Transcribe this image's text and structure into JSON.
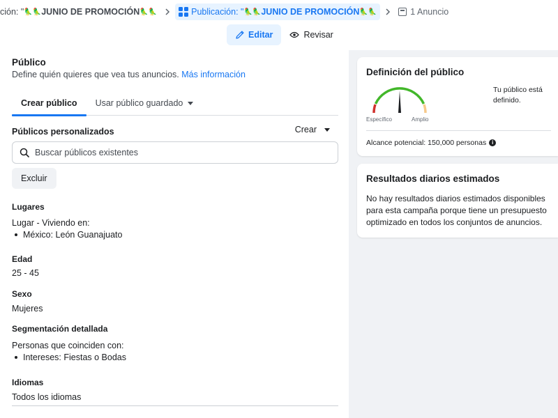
{
  "breadcrumbs": {
    "campaign": {
      "prefix": "ción: \"",
      "emoji_left": "🦜🦜",
      "name": "JUNIO DE PROMOCIÓN",
      "emoji_right": "🦜🦜"
    },
    "adset": {
      "prefix": "Publicación: \"",
      "emoji_left": "🦜🦜",
      "name": "JUNIO DE PROMOCIÓN",
      "emoji_right": "🦜🦜"
    },
    "ad": {
      "label": "1 Anuncio"
    }
  },
  "modes": {
    "edit": "Editar",
    "review": "Revisar"
  },
  "audience": {
    "title": "Público",
    "description": "Define quién quieres que vea tus anuncios.",
    "more_info": "Más información",
    "tabs": {
      "create": "Crear público",
      "saved": "Usar público guardado"
    },
    "custom": {
      "label": "Públicos personalizados",
      "create_label": "Crear",
      "search_placeholder": "Buscar públicos existentes",
      "exclude_label": "Excluir"
    },
    "locations": {
      "label": "Lugares",
      "prefix": "Lugar - Viviendo en:",
      "items": [
        "México: León Guanajuato"
      ]
    },
    "age": {
      "label": "Edad",
      "value": "25 - 45"
    },
    "gender": {
      "label": "Sexo",
      "value": "Mujeres"
    },
    "detailed": {
      "label": "Segmentación detallada",
      "prefix": "Personas que coinciden con:",
      "items": [
        "Intereses: Fiestas o Bodas"
      ]
    },
    "languages": {
      "label": "Idiomas",
      "value": "Todos los idiomas"
    }
  },
  "definition_card": {
    "title": "Definición del público",
    "specific_label": "Específico",
    "broad_label": "Amplio",
    "status": "Tu público está definido.",
    "reach": "Alcance potencial: 150,000 personas",
    "gauge_level": 0.5,
    "colors": {
      "specific": "#d0312d",
      "center": "#42b72a",
      "broad": "#f7c98a",
      "needle": "#1c1e21"
    }
  },
  "results_card": {
    "title": "Resultados diarios estimados",
    "body": "No hay resultados diarios estimados disponibles para esta campaña porque tiene un presupuesto optimizado en todos los conjuntos de anuncios."
  },
  "colors": {
    "accent": "#1877f2",
    "active_bg": "#e7f3ff",
    "page_bg": "#f0f2f5"
  }
}
